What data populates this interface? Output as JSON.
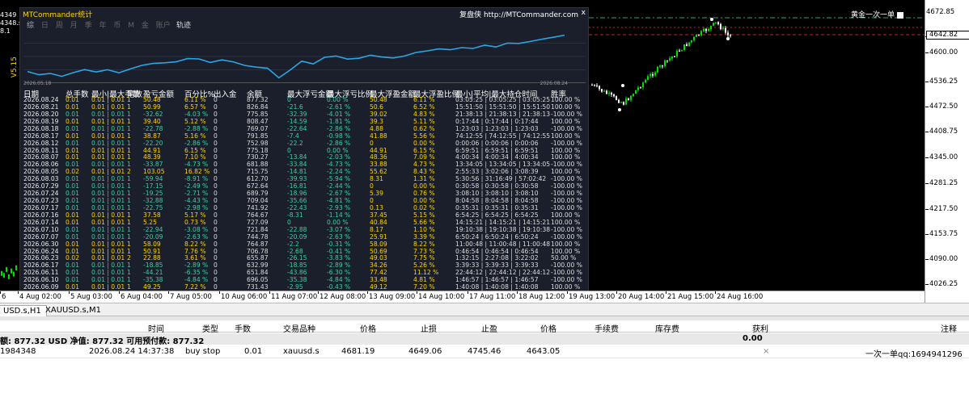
{
  "panel": {
    "title": "MTCommander统计",
    "brand": "复盘侠 http://MTCommander.com",
    "close": "x",
    "tabs": [
      "综",
      "日",
      "周",
      "月",
      "季",
      "年",
      "币",
      "M",
      "金",
      "账户"
    ],
    "curve_label": "轨迹",
    "mini_start": "2026.05.18",
    "mini_end": "2026.08.24",
    "columns": [
      "日期",
      "总手数",
      "最小|最大手数",
      "笔数",
      "盈亏金额",
      "百分比%",
      "出入金",
      "余额",
      "最大浮亏金额",
      "最大浮亏比例",
      "最大浮盈金额",
      "最大浮盈比例",
      "最小|平均|最大持仓时间",
      "胜率"
    ],
    "rows": [
      [
        "2026.08.24",
        "0.01",
        "0.01 | 0.01",
        "1",
        "50.48",
        "6.11 %",
        "0",
        "877.32",
        "0",
        "0.00 %",
        "50.48",
        "6.11 %",
        "03:05:25 | 03:05:25 | 03:05:25",
        "100.00 %"
      ],
      [
        "2026.08.21",
        "0.01",
        "0.01 | 0.01",
        "1",
        "50.99",
        "6.57 %",
        "0",
        "826.84",
        "-21.6",
        "-2.61 %",
        "50.6",
        "6.52 %",
        "15:51:50 | 15:51:50 | 15:51:50",
        "100.00 %"
      ],
      [
        "2026.08.20",
        "0.01",
        "0.01 | 0.01",
        "1",
        "-32.62",
        "-4.03 %",
        "0",
        "775.85",
        "-32.39",
        "-4.01 %",
        "39.02",
        "4.83 %",
        "21:38:13 | 21:38:13 | 21:38:13",
        "-100.00 %"
      ],
      [
        "2026.08.19",
        "0.01",
        "0.01 | 0.01",
        "1",
        "39.40",
        "5.12 %",
        "0",
        "808.47",
        "-14.59",
        "-1.81 %",
        "39.3",
        "5.11 %",
        "0:17:44 | 0:17:44 | 0:17:44",
        "100.00 %"
      ],
      [
        "2026.08.18",
        "0.01",
        "0.01 | 0.01",
        "1",
        "-22.78",
        "-2.88 %",
        "0",
        "769.07",
        "-22.64",
        "-2.86 %",
        "4.88",
        "0.62 %",
        "1:23:03 | 1:23:03 | 1:23:03",
        "-100.00 %"
      ],
      [
        "2026.08.17",
        "0.01",
        "0.01 | 0.01",
        "1",
        "38.87",
        "5.16 %",
        "0",
        "791.85",
        "-7.4",
        "-0.98 %",
        "41.88",
        "5.56 %",
        "74:12:55 | 74:12:55 | 74:12:55",
        "100.00 %"
      ],
      [
        "2026.08.12",
        "0.01",
        "0.01 | 0.01",
        "1",
        "-22.20",
        "-2.86 %",
        "0",
        "752.98",
        "-22.2",
        "-2.86 %",
        "0",
        "0.00 %",
        "0:00:06 | 0:00:06 | 0:00:06",
        "-100.00 %"
      ],
      [
        "2026.08.11",
        "0.01",
        "0.01 | 0.01",
        "1",
        "44.91",
        "6.15 %",
        "0",
        "775.18",
        "0",
        "0.00 %",
        "44.91",
        "6.15 %",
        "6:59:51 | 6:59:51 | 6:59:51",
        "100.00 %"
      ],
      [
        "2026.08.07",
        "0.01",
        "0.01 | 0.01",
        "1",
        "48.39",
        "7.10 %",
        "0",
        "730.27",
        "-13.84",
        "-2.03 %",
        "48.36",
        "7.09 %",
        "4:00:34 | 4:00:34 | 4:00:34",
        "100.00 %"
      ],
      [
        "2026.08.06",
        "0.01",
        "0.01 | 0.01",
        "1",
        "-33.87",
        "-4.73 %",
        "0",
        "681.88",
        "-33.84",
        "-4.73 %",
        "33.88",
        "4.73 %",
        "13:34:05 | 13:34:05 | 13:34:05",
        "-100.00 %"
      ],
      [
        "2026.08.05",
        "0.02",
        "0.01 | 0.01",
        "2",
        "103.05",
        "16.82 %",
        "0",
        "715.75",
        "-14.81",
        "-2.24 %",
        "55.62",
        "8.43 %",
        "2:55:33 | 3:02:06 | 3:08:39",
        "100.00 %"
      ],
      [
        "2026.08.03",
        "0.01",
        "0.01 | 0.01",
        "1",
        "-59.94",
        "-8.91 %",
        "0",
        "612.70",
        "-39.93",
        "-5.94 %",
        "8.31",
        "1.31 %",
        "5:30:56 | 31:16:49 | 57:02:42",
        "-100.00 %"
      ],
      [
        "2026.07.29",
        "0.01",
        "0.01 | 0.01",
        "1",
        "-17.15",
        "-2.49 %",
        "0",
        "672.64",
        "-16.81",
        "-2.44 %",
        "0",
        "0.00 %",
        "0:30:58 | 0:30:58 | 0:30:58",
        "-100.00 %"
      ],
      [
        "2026.07.24",
        "0.01",
        "0.01 | 0.01",
        "1",
        "-19.25",
        "-2.71 %",
        "0",
        "689.79",
        "-18.96",
        "-2.67 %",
        "5.39",
        "0.76 %",
        "3:08:10 | 3:08:10 | 3:08:10",
        "-100.00 %"
      ],
      [
        "2026.07.23",
        "0.01",
        "0.01 | 0.01",
        "1",
        "-32.88",
        "-4.43 %",
        "0",
        "709.04",
        "-35.66",
        "-4.81 %",
        "0",
        "0.00 %",
        "8:04:58 | 8:04:58 | 8:04:58",
        "-100.00 %"
      ],
      [
        "2026.07.17",
        "0.01",
        "0.01 | 0.01",
        "1",
        "-22.75",
        "-2.98 %",
        "0",
        "741.92",
        "-22.43",
        "-2.93 %",
        "0.13",
        "0.02 %",
        "0:35:31 | 0:35:31 | 0:35:31",
        "-100.00 %"
      ],
      [
        "2026.07.16",
        "0.01",
        "0.01 | 0.01",
        "1",
        "37.58",
        "5.17 %",
        "0",
        "764.67",
        "-8.31",
        "-1.14 %",
        "37.45",
        "5.15 %",
        "6:54:25 | 6:54:25 | 6:54:25",
        "100.00 %"
      ],
      [
        "2026.07.14",
        "0.01",
        "0.01 | 0.01",
        "1",
        "5.25",
        "0.73 %",
        "0",
        "727.09",
        "0",
        "0.00 %",
        "40.84",
        "5.66 %",
        "14:15:21 | 14:15:21 | 14:15:21",
        "100.00 %"
      ],
      [
        "2026.07.10",
        "0.01",
        "0.01 | 0.01",
        "1",
        "-22.94",
        "-3.08 %",
        "0",
        "721.84",
        "-22.88",
        "-3.07 %",
        "8.17",
        "1.10 %",
        "19:10:38 | 19:10:38 | 19:10:38",
        "-100.00 %"
      ],
      [
        "2026.07.07",
        "0.01",
        "0.01 | 0.01",
        "1",
        "-20.09",
        "-2.63 %",
        "0",
        "744.78",
        "-20.09",
        "-2.63 %",
        "25.91",
        "3.39 %",
        "6:50:24 | 6:50:24 | 6:50:24",
        "-100.00 %"
      ],
      [
        "2026.06.30",
        "0.01",
        "0.01 | 0.01",
        "1",
        "58.09",
        "8.22 %",
        "0",
        "764.87",
        "-2.2",
        "-0.31 %",
        "58.09",
        "8.22 %",
        "11:00:48 | 11:00:48 | 11:00:48",
        "100.00 %"
      ],
      [
        "2026.06.24",
        "0.01",
        "0.01 | 0.01",
        "1",
        "50.91",
        "7.76 %",
        "0",
        "706.78",
        "-2.68",
        "-0.41 %",
        "50.69",
        "7.73 %",
        "0:46:54 | 0:46:54 | 0:46:54",
        "100.00 %"
      ],
      [
        "2026.06.23",
        "0.02",
        "0.01 | 0.01",
        "2",
        "22.88",
        "3.61 %",
        "0",
        "655.87",
        "-26.15",
        "-3.83 %",
        "49.03",
        "7.75 %",
        "1:32:15 | 2:27:08 | 3:22:02",
        "50.00 %"
      ],
      [
        "2026.06.17",
        "0.01",
        "0.01 | 0.01",
        "1",
        "-18.85",
        "-2.89 %",
        "0",
        "632.99",
        "-18.85",
        "-2.89 %",
        "34.26",
        "5.26 %",
        "3:39:33 | 3:39:33 | 3:39:33",
        "-100.00 %"
      ],
      [
        "2026.06.11",
        "0.01",
        "0.01 | 0.01",
        "1",
        "-44.21",
        "-6.35 %",
        "0",
        "651.84",
        "-43.86",
        "-6.30 %",
        "77.42",
        "11.12 %",
        "22:44:12 | 22:44:12 | 22:44:12",
        "-100.00 %"
      ],
      [
        "2026.06.10",
        "0.01",
        "0.01 | 0.01",
        "1",
        "-35.38",
        "-4.84 %",
        "0",
        "696.05",
        "-35.38",
        "-4.84 %",
        "33.48",
        "4.81 %",
        "1:46:57 | 1:46:57 | 1:46:57",
        "-100.00 %"
      ],
      [
        "2026.06.09",
        "0.01",
        "0.01 | 0.01",
        "1",
        "49.25",
        "7.22 %",
        "0",
        "731.43",
        "-2.95",
        "-0.43 %",
        "49.12",
        "7.20 %",
        "1:40:08 | 1:40:08 | 1:40:08",
        "100.00 %"
      ]
    ]
  },
  "equity_curve": [
    652,
    632,
    640,
    622,
    645,
    664,
    649,
    663,
    644,
    668,
    690,
    702,
    706,
    712,
    732,
    730,
    708,
    724,
    712,
    690,
    679,
    673,
    613,
    662,
    716,
    699,
    740,
    748,
    729,
    734,
    753,
    742,
    736,
    748,
    770,
    780,
    792,
    787,
    800,
    795,
    815,
    804,
    828,
    826,
    838,
    852,
    864,
    877
  ],
  "chart": {
    "symbol_label": "黄金一次一单",
    "left_tags": [
      "4349",
      "4348.s",
      "8.1"
    ],
    "side_label": "V5.15",
    "price_ticks": [
      "4672.85",
      "4600.00",
      "4536.25",
      "4472.50",
      "4408.75",
      "4345.00",
      "4281.25",
      "4217.50",
      "4153.75",
      "4090.00",
      "4026.25"
    ],
    "current_price": "4642.82",
    "time_ticks": [
      "6",
      "4 Aug 02:00",
      "5 Aug 03:00",
      "6 Aug 04:00",
      "7 Aug 05:00",
      "10 Aug 06:00",
      "11 Aug 07:00",
      "12 Aug 08:00",
      "13 Aug 09:00",
      "14 Aug 10:00",
      "17 Aug 11:00",
      "18 Aug 12:00",
      "19 Aug 13:00",
      "20 Aug 14:00",
      "21 Aug 15:00",
      "24 Aug 16:00"
    ],
    "colors": {
      "bull": "#00e000",
      "bear": "#ffffff",
      "line_red": "#cc2222",
      "line_green": "#22aa66"
    }
  },
  "symbol_tabs": [
    "USD.s,H1",
    "XAUUSD.s,M1"
  ],
  "terminal": {
    "headers": [
      "时间",
      "类型",
      "手数",
      "交易品种",
      "价格",
      "止损",
      "止盈",
      "价格",
      "手续费",
      "库存费",
      "获利",
      "注释"
    ],
    "balance_text": "额: 877.32 USD  净值: 877.32  可用预付款: 877.32",
    "balance_profit": "0.00",
    "order": {
      "ticket": "1984348",
      "time": "2026.08.24 14:37:38",
      "type": "buy stop",
      "volume": "0.01",
      "symbol": "xauusd.s",
      "price": "4681.19",
      "sl": "4649.06",
      "tp": "4745.46",
      "cur_price": "4643.05",
      "close_icon": "×",
      "comment": "一次一单qq:1694941296"
    }
  }
}
